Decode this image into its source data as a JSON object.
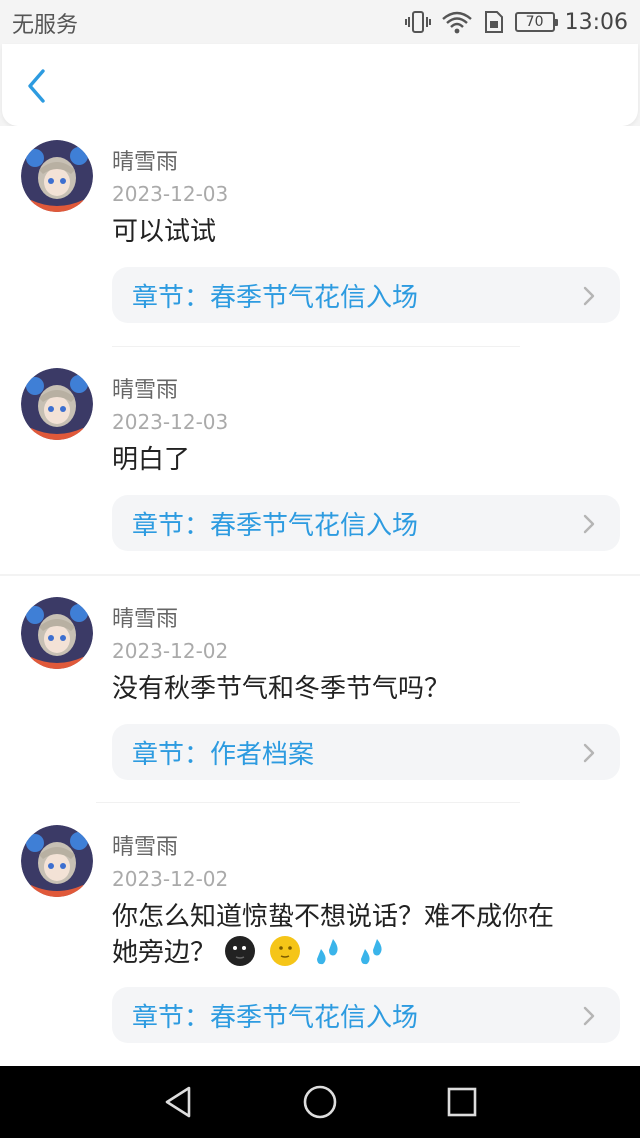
{
  "status_bar": {
    "carrier": "无服务",
    "battery": "70",
    "time": "13:06"
  },
  "header": {
    "back_icon": "chevron-left-icon",
    "accent_color": "#2d9be0"
  },
  "comments": [
    {
      "user": "晴雪雨",
      "date": "2023-12-03",
      "text": "可以试试",
      "chapter": "章节：春季节气花信入场"
    },
    {
      "user": "晴雪雨",
      "date": "2023-12-03",
      "text": "明白了",
      "chapter": "章节：春季节气花信入场"
    },
    {
      "user": "晴雪雨",
      "date": "2023-12-02",
      "text": "没有秋季节气和冬季节气吗？",
      "chapter": "章节：作者档案"
    },
    {
      "user": "晴雪雨",
      "date": "2023-12-02",
      "text_line1": "你怎么知道惊蛰不想说话？难不成你在",
      "text_line2": "她旁边？",
      "emojis": [
        "dark-moon-face-icon",
        "moon-face-icon",
        "sweat-drops-icon",
        "sweat-drops-icon"
      ],
      "chapter": "章节：春季节气花信入场"
    }
  ],
  "navbar": {
    "back": "triangle-back-icon",
    "home": "circle-home-icon",
    "recents": "square-recents-icon"
  }
}
